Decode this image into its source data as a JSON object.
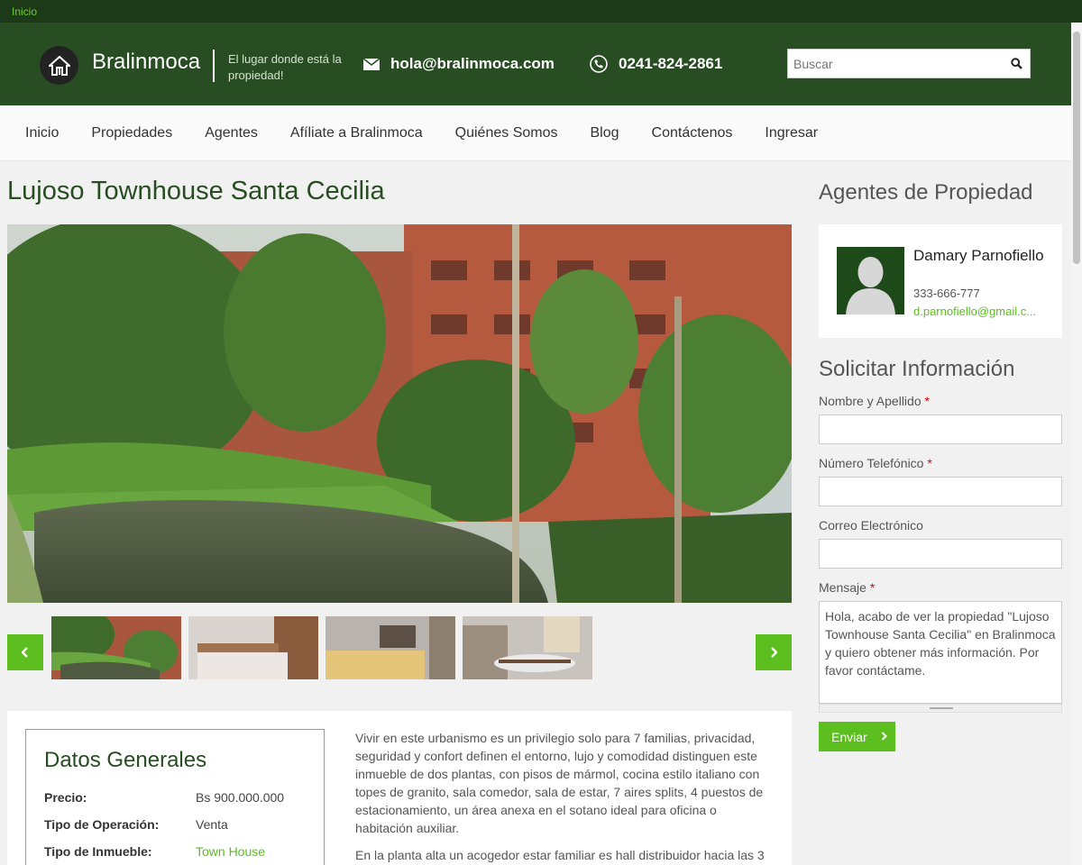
{
  "topbar": {
    "link": "Inicio"
  },
  "header": {
    "brand": "Bralinmoca",
    "tagline": "El lugar donde está la propiedad!",
    "email": "hola@bralinmoca.com",
    "phone": "0241-824-2861",
    "search_placeholder": "Buscar"
  },
  "nav": {
    "items": [
      "Inicio",
      "Propiedades",
      "Agentes",
      "Afíliate a Bralinmoca",
      "Quiénes Somos",
      "Blog",
      "Contáctenos",
      "Ingresar"
    ]
  },
  "property": {
    "title": "Lujoso Townhouse Santa Cecilia",
    "description": [
      "Vivir en este urbanismo es un privilegio solo para 7 familias, privacidad, seguridad y confort definen el entorno, lujo y comodidad distinguen este inmueble de dos plantas, con pisos de mármol, cocina estilo italiano con topes de granito, sala comedor, sala de estar, 7 aires splits, 4 puestos de estacionamiento, un área anexa en el sotano ideal para oficina o habitación auxiliar.",
      "En la planta alta un acogedor estar familiar es hall distribuidor hacia las 3"
    ]
  },
  "datos": {
    "title": "Datos Generales",
    "rows": [
      {
        "label": "Precio:",
        "value": "Bs 900.000.000"
      },
      {
        "label": "Tipo de Operación:",
        "value": "Venta"
      },
      {
        "label": "Tipo de Inmueble:",
        "value": "Town House"
      }
    ]
  },
  "sidebar": {
    "agents_title": "Agentes de Propiedad",
    "agent": {
      "name": "Damary Parnofiello",
      "phone": "333-666-777",
      "email": "d.parnofiello@gmail.c..."
    },
    "form": {
      "title": "Solicitar Información",
      "name_label": "Nombre y Apellido",
      "phone_label": "Número Telefónico",
      "email_label": "Correo Electrónico",
      "message_label": "Mensaje",
      "required_mark": "*",
      "message_value": "Hola, acabo de ver la propiedad \"Lujoso Townhouse Santa Cecilia\" en Bralinmoca y quiero obtener más información. Por favor contáctame.",
      "submit_label": "Enviar"
    }
  },
  "colors": {
    "header_bg": "#284d22",
    "topbar_bg": "#1c3a17",
    "accent": "#5cbf1f",
    "title": "#284d22"
  }
}
